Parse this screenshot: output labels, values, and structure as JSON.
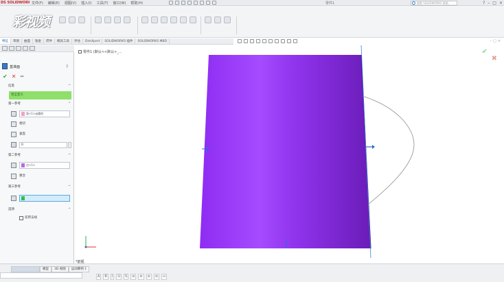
{
  "app": {
    "logo_text": "DS SOLIDWORKS",
    "menus": [
      "文件(F)",
      "编辑(E)",
      "视图(V)",
      "插入(I)",
      "工具(T)",
      "窗口(W)",
      "帮助(H)"
    ],
    "doc_title": "零件1",
    "search_placeholder": "搜索 SOLIDWORKS 帮助",
    "window_controls": [
      "?",
      "–",
      "□",
      "×"
    ]
  },
  "watermark": "彩视频",
  "command_tabs": [
    "特征",
    "草图",
    "曲面",
    "钣金",
    "焊件",
    "模具工具",
    "评估",
    "DimXpert",
    "SOLIDWORKS 插件",
    "SOLIDWORKS MBD"
  ],
  "property_manager": {
    "title": "基准面",
    "help": "?",
    "ok": "✔",
    "cancel": "✕",
    "pin": "↔",
    "section_message": "信息",
    "message_text": "完全定义",
    "first_ref": {
      "label": "第一参考",
      "selection": "面<1>@圆柱",
      "options": [
        "相切",
        "垂直"
      ],
      "count_value": "0"
    },
    "second_ref": {
      "label": "第二参考",
      "selection": "点<1>",
      "options": [
        "重合"
      ]
    },
    "third_ref": {
      "label": "第三参考",
      "selection": ""
    },
    "options": {
      "label": "选项",
      "checkbox": "反转法线"
    }
  },
  "viewport": {
    "tree_root": "零件1 (默认<<默认>_...",
    "confirm_ok": "✔",
    "confirm_cancel": "✖",
    "section_label": "*前视"
  },
  "bottom": {
    "tabs": [
      "模型",
      "3D 视图",
      "运动算例 1"
    ],
    "format_tools": [
      "A",
      "B",
      "I",
      "U",
      "S",
      "≡",
      "≡",
      "≡",
      "≡",
      "↔"
    ]
  },
  "colors": {
    "solid_face": "#8a2be2",
    "message_bar": "#8ee06a",
    "active_selection": "#d3ecfb"
  }
}
